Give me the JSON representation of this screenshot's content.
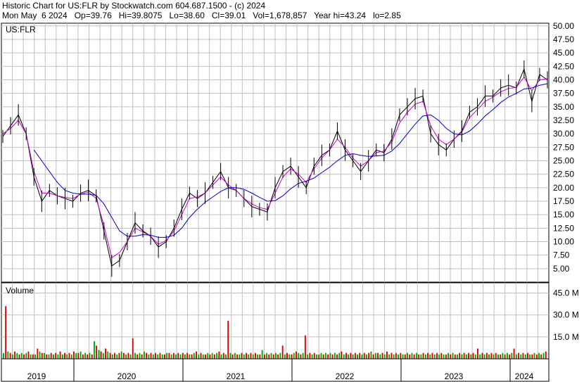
{
  "header": {
    "line1": "Historic Chart for US:FLR by Stockwatch.com 604.687.1500 - (c) 2024",
    "line2": "Mon May  6 2024   Op=39.76   Hi=39.8075   Lo=38.60   Cl=39.01   Vol=1,678,857   Year hi=43.24   lo=2.85"
  },
  "price_panel": {
    "label": "US:FLR"
  },
  "volume_panel": {
    "label": "Volume"
  },
  "colors": {
    "price": "#000000",
    "ma_short": "#cc00cc",
    "ma_long": "#0000cc",
    "volume_up": "#00aa00",
    "volume_down": "#dd0000",
    "grid": "#c0c0c0"
  },
  "chart_data": [
    {
      "type": "line",
      "x_labels": [
        "2019",
        "2020",
        "2021",
        "2022",
        "2023",
        "2024"
      ],
      "y_ticks": [
        "50.00",
        "47.50",
        "45.00",
        "42.50",
        "40.00",
        "37.50",
        "35.00",
        "32.50",
        "30.00",
        "27.50",
        "25.00",
        "22.50",
        "20.00",
        "17.50",
        "15.00",
        "12.50",
        "10.00",
        "7.50",
        "5.00"
      ],
      "ylim": [
        2.5,
        50.5
      ],
      "grid": true,
      "series": [
        {
          "values": [
            29.5,
            31.5,
            33.5,
            30.0,
            22.0,
            17.5,
            19.5,
            18.5,
            18.0,
            17.5,
            19.0,
            19.5,
            18.5,
            12.0,
            5.5,
            6.5,
            10.0,
            13.5,
            12.0,
            11.0,
            9.0,
            10.0,
            12.5,
            16.0,
            19.0,
            18.0,
            19.0,
            21.0,
            23.0,
            20.0,
            19.5,
            18.0,
            16.5,
            16.0,
            15.5,
            20.0,
            23.0,
            24.0,
            22.0,
            20.0,
            24.0,
            26.0,
            27.0,
            30.5,
            27.0,
            25.0,
            23.0,
            25.0,
            27.0,
            26.5,
            29.0,
            33.5,
            35.0,
            36.5,
            37.0,
            30.0,
            28.0,
            27.0,
            29.0,
            30.5,
            34.0,
            35.0,
            37.0,
            37.0,
            38.5,
            39.0,
            38.5,
            42.0,
            36.0,
            41.0,
            40.0
          ]
        },
        {
          "values": [
            30.0,
            31.0,
            32.5,
            30.0,
            23.0,
            19.0,
            19.0,
            18.5,
            18.2,
            18.0,
            18.8,
            19.2,
            18.0,
            13.0,
            7.0,
            8.0,
            10.0,
            12.5,
            11.8,
            11.0,
            9.5,
            10.2,
            12.0,
            15.0,
            18.0,
            18.3,
            19.0,
            20.5,
            22.0,
            20.5,
            19.5,
            18.0,
            17.0,
            16.3,
            16.0,
            19.0,
            22.0,
            23.5,
            22.5,
            21.0,
            23.5,
            25.5,
            27.0,
            29.0,
            27.5,
            25.5,
            24.0,
            25.0,
            26.5,
            26.8,
            28.5,
            32.0,
            34.0,
            35.5,
            36.0,
            31.5,
            29.0,
            28.0,
            29.0,
            30.3,
            33.0,
            34.5,
            36.0,
            36.8,
            37.8,
            38.4,
            38.6,
            40.5,
            38.0,
            40.0,
            40.2
          ]
        },
        {
          "values": [
            null,
            null,
            null,
            null,
            27.0,
            25.0,
            23.0,
            21.0,
            19.5,
            19.0,
            18.8,
            18.8,
            18.6,
            17.0,
            14.5,
            12.0,
            11.0,
            11.0,
            11.3,
            11.2,
            10.8,
            10.8,
            11.2,
            12.5,
            14.5,
            16.0,
            17.3,
            18.3,
            19.3,
            20.0,
            20.0,
            19.7,
            19.0,
            18.2,
            17.5,
            17.6,
            18.5,
            19.8,
            20.8,
            21.2,
            21.8,
            22.8,
            23.8,
            25.0,
            26.0,
            26.3,
            26.0,
            25.8,
            25.9,
            26.0,
            26.8,
            28.2,
            30.0,
            31.8,
            33.3,
            33.5,
            32.5,
            31.0,
            30.0,
            29.8,
            30.5,
            31.8,
            33.3,
            34.5,
            35.8,
            36.8,
            37.5,
            38.3,
            38.5,
            39.0,
            39.3
          ]
        }
      ]
    },
    {
      "type": "bar",
      "title": "Volume",
      "y_ticks": [
        "45.0 M",
        "30.0 M",
        "15.0 M"
      ],
      "ylim": [
        0,
        52
      ],
      "values": [
        4,
        36,
        5,
        4,
        3,
        5,
        4,
        3,
        4,
        3,
        4,
        5,
        3,
        3,
        3,
        7,
        5,
        4,
        4,
        3,
        3,
        4,
        3,
        4,
        3,
        5,
        3,
        4,
        3,
        4,
        3,
        5,
        4,
        4,
        5,
        3,
        4,
        3,
        4,
        3,
        12,
        9,
        6,
        5,
        4,
        7,
        5,
        4,
        3,
        4,
        3,
        4,
        5,
        4,
        3,
        4,
        3,
        14,
        4,
        3,
        4,
        3,
        5,
        4,
        3,
        4,
        3,
        4,
        3,
        4,
        3,
        3,
        4,
        4,
        3,
        4,
        3,
        4,
        3,
        4,
        3,
        4,
        3,
        3,
        4,
        5,
        3,
        4,
        3,
        3,
        4,
        3,
        4,
        3,
        4,
        5,
        3,
        4,
        3,
        26,
        4,
        3,
        4,
        3,
        3,
        4,
        3,
        4,
        3,
        4,
        3,
        4,
        3,
        3,
        6,
        3,
        4,
        3,
        4,
        3,
        4,
        3,
        4,
        9,
        3,
        4,
        3,
        3,
        4,
        5,
        4,
        3,
        4,
        16,
        3,
        4,
        3,
        4,
        3,
        3,
        4,
        3,
        4,
        3,
        4,
        3,
        4,
        3,
        4,
        5,
        3,
        4,
        3,
        4,
        3,
        4,
        3,
        4,
        3,
        4,
        3,
        4,
        5,
        3,
        4,
        4,
        3,
        4,
        3,
        5,
        3,
        4,
        3,
        4,
        3,
        4,
        3,
        3,
        4,
        3,
        4,
        3,
        4,
        3,
        3,
        4,
        3,
        4,
        3,
        4,
        3,
        4,
        3,
        4,
        3,
        3,
        4,
        3,
        4,
        3,
        3,
        4,
        3,
        4,
        3,
        4,
        3,
        4,
        3,
        7,
        3,
        4,
        3,
        4,
        3,
        4,
        3,
        4,
        3,
        3,
        4,
        3,
        4,
        3,
        4,
        7,
        3,
        4,
        3,
        4,
        3,
        4,
        3,
        3,
        4,
        3,
        4,
        3,
        4,
        5
      ]
    }
  ]
}
